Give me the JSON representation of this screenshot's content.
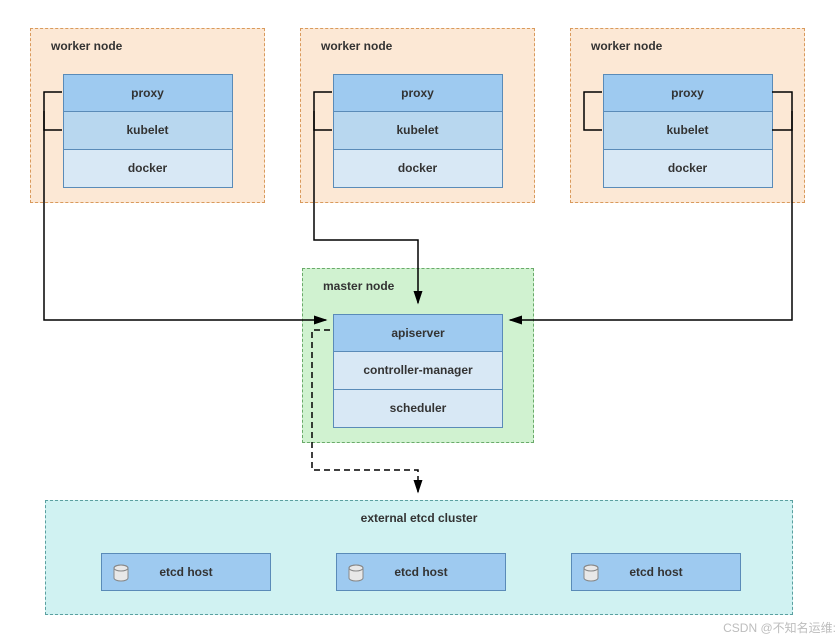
{
  "worker_nodes": [
    {
      "title": "worker node",
      "proxy": "proxy",
      "kubelet": "kubelet",
      "docker": "docker"
    },
    {
      "title": "worker node",
      "proxy": "proxy",
      "kubelet": "kubelet",
      "docker": "docker"
    },
    {
      "title": "worker node",
      "proxy": "proxy",
      "kubelet": "kubelet",
      "docker": "docker"
    }
  ],
  "master_node": {
    "title": "master node",
    "apiserver": "apiserver",
    "controller": "controller-manager",
    "scheduler": "scheduler"
  },
  "etcd_cluster": {
    "title": "external etcd cluster",
    "hosts": [
      "etcd host",
      "etcd host",
      "etcd host"
    ]
  },
  "watermark": "CSDN @不知名运维:"
}
